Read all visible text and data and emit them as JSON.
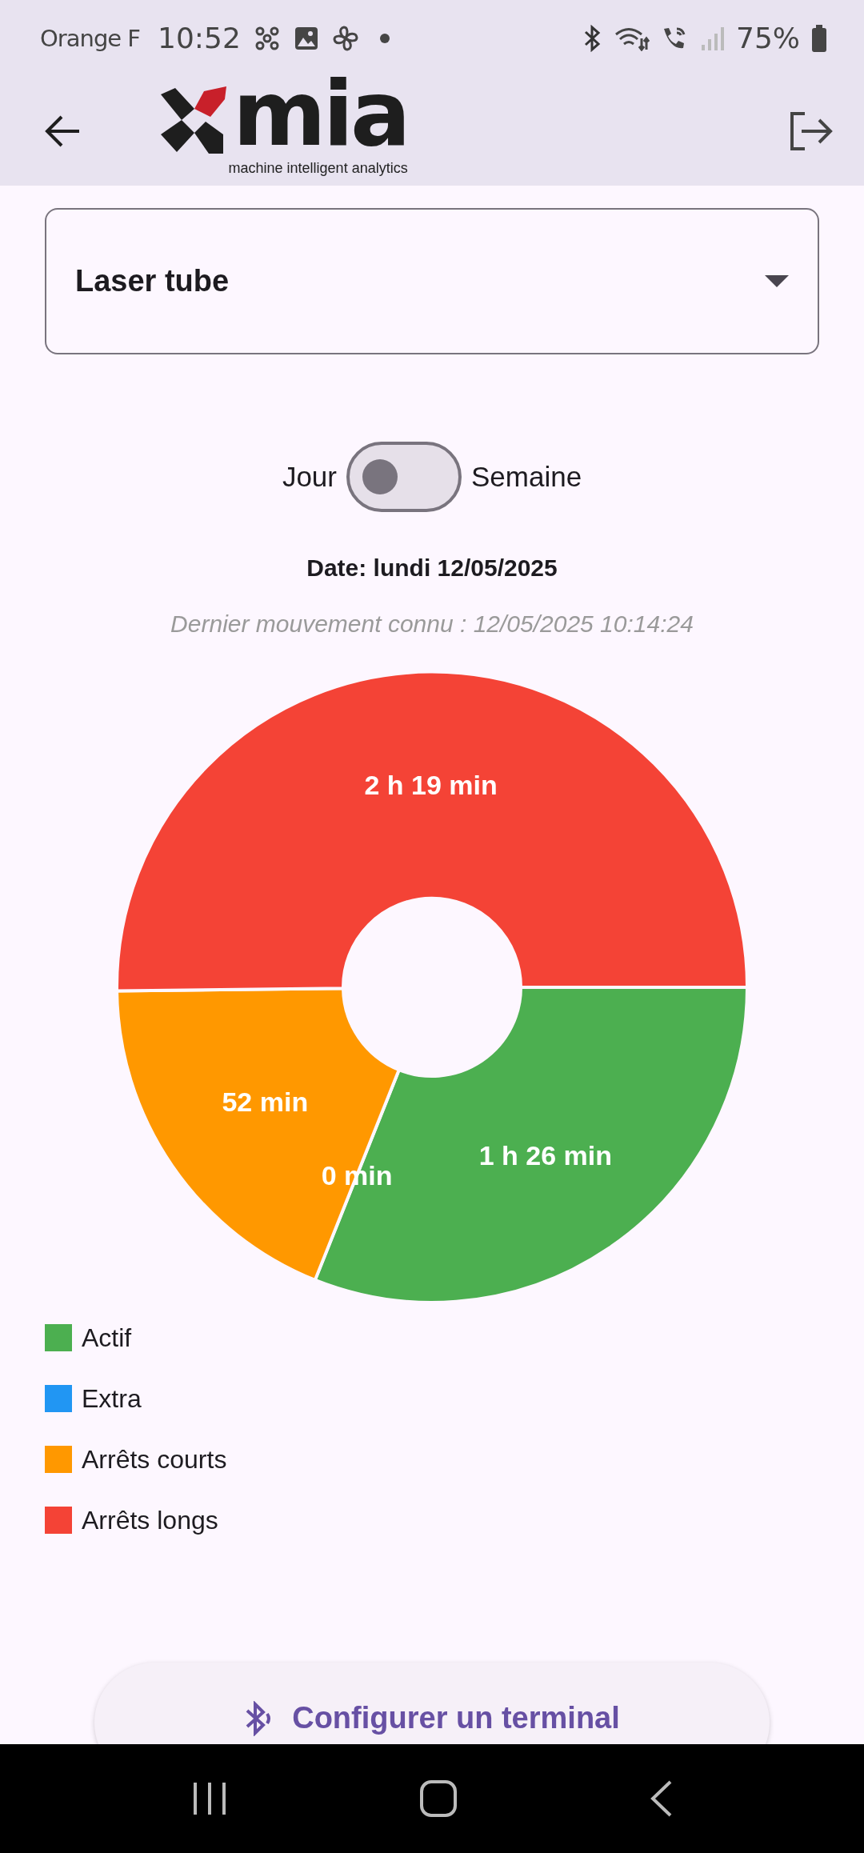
{
  "status_bar": {
    "carrier": "Orange F",
    "time": "10:52",
    "battery": "75%"
  },
  "header": {
    "logo": {
      "text": "mia",
      "tagline": "machine intelligent analytics"
    }
  },
  "machine_select": {
    "value": "Laser tube"
  },
  "period_toggle": {
    "left_label": "Jour",
    "right_label": "Semaine",
    "on": false
  },
  "date": "Date: lundi 12/05/2025",
  "last_movement": "Dernier mouvement connu : 12/05/2025 10:14:24",
  "chart": {
    "chart_data": {
      "type": "donut",
      "categories": [
        "Actif",
        "Extra",
        "Arrêts courts",
        "Arrêts longs"
      ],
      "values": [
        31.05,
        0,
        18.77,
        50.18
      ]
    },
    "slice_labels": [
      "1 h 26 min",
      "0 min",
      "52 min",
      "2 h 19 min"
    ]
  },
  "legend": [
    {
      "color": "#4caf50"
    },
    {
      "color": "#2196f3"
    },
    {
      "color": "#ff9800"
    },
    {
      "color": "#f44336"
    }
  ],
  "configure_button": {
    "label": "Configurer un terminal"
  }
}
